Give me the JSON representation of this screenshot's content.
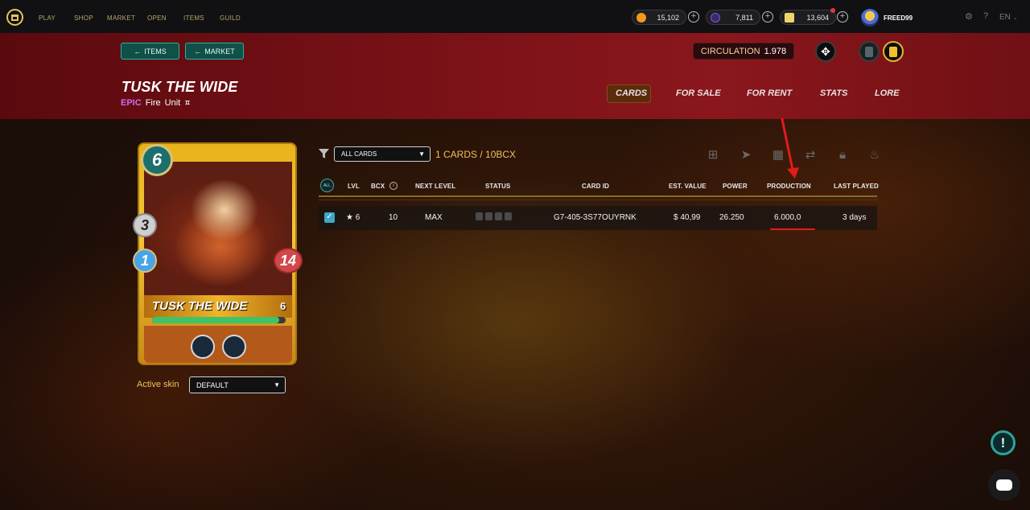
{
  "nav": {
    "links": [
      "PLAY",
      "SHOP",
      "MARKET",
      "OPEN",
      "ITEMS",
      "GUILD"
    ],
    "balances": [
      {
        "value": "15,102",
        "icon": "coin-icon",
        "color": "#f29a1a"
      },
      {
        "value": "7,811",
        "icon": "gem-icon",
        "color": "#7b58d6"
      },
      {
        "value": "13,604",
        "icon": "scroll-icon",
        "color": "#f0d36a"
      }
    ],
    "username": "FREED99",
    "language": "EN"
  },
  "hero": {
    "back_items": "ITEMS",
    "back_market": "MARKET",
    "card_title": "TUSK THE WIDE",
    "rarity": "EPIC",
    "element": "Fire",
    "type": "Unit",
    "circulation_label": "CIRCULATION",
    "circulation_value": "1.978",
    "tabs": [
      "CARDS",
      "FOR SALE",
      "FOR RENT",
      "STATS",
      "LORE"
    ],
    "active_tab": "CARDS"
  },
  "card": {
    "name": "TUSK THE WIDE",
    "level": "6",
    "mana": "6",
    "attack": "3",
    "speed": "1",
    "health": "14",
    "health_fill": 0.95
  },
  "skin": {
    "label": "Active skin",
    "selected": "DEFAULT"
  },
  "table": {
    "filter_selected": "ALL CARDS",
    "count_label": "1 CARDS / 10BCX",
    "all_badge": "ALL",
    "headers": [
      "LVL",
      "BCX",
      "NEXT LEVEL",
      "STATUS",
      "CARD ID",
      "EST. VALUE",
      "POWER",
      "PRODUCTION",
      "LAST PLAYED"
    ],
    "rows": [
      {
        "lvl": "★ 6",
        "bcx": "10",
        "next_level": "MAX",
        "card_id": "G7-405-3S77OUYRNK",
        "est_value": "$ 40,99",
        "power": "26.250",
        "production": "6.000,0",
        "last_played": "3 days"
      }
    ]
  },
  "colors": {
    "accent_gold": "#f0c05a",
    "teal": "#2cb0a0",
    "annotation_red": "#e21b1b"
  }
}
